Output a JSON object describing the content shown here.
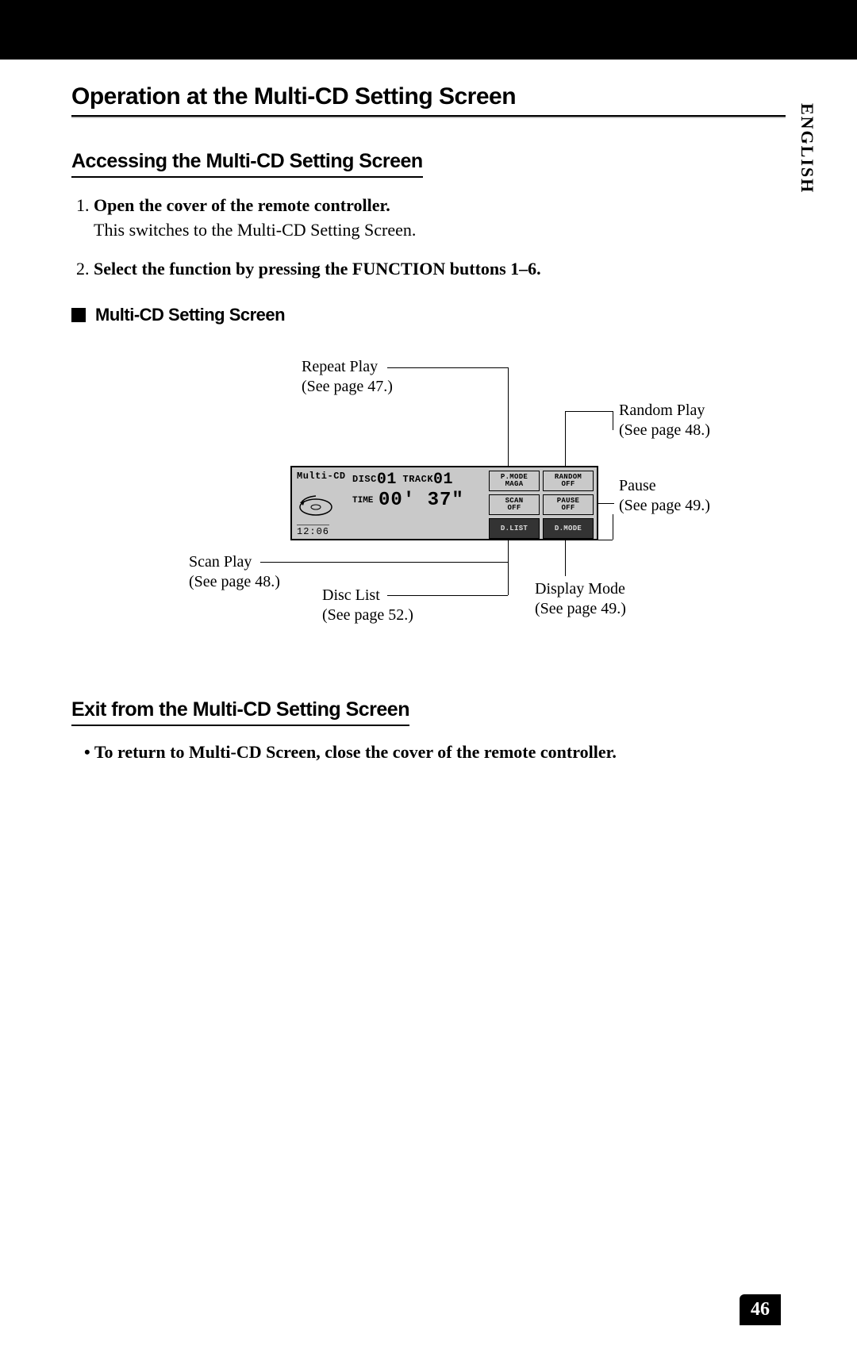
{
  "language_tab": "ENGLISH",
  "section_title": "Operation at the Multi-CD Setting Screen",
  "accessing": {
    "heading": "Accessing the Multi-CD Setting Screen",
    "steps": [
      {
        "main": "Open the cover of the remote controller.",
        "sub": "This switches to the Multi-CD Setting Screen."
      },
      {
        "main": "Select the function by pressing the FUNCTION buttons 1–6.",
        "sub": ""
      }
    ]
  },
  "screen_heading": "Multi-CD Setting Screen",
  "callouts": {
    "repeat": {
      "title": "Repeat Play",
      "ref": "(See page 47.)"
    },
    "random": {
      "title": "Random Play",
      "ref": "(See page 48.)"
    },
    "pause": {
      "title": "Pause",
      "ref": "(See page 49.)"
    },
    "scan": {
      "title": "Scan Play",
      "ref": "(See page 48.)"
    },
    "disclist": {
      "title": "Disc List",
      "ref": "(See page 52.)"
    },
    "dispmode": {
      "title": "Display Mode",
      "ref": "(See page 49.)"
    }
  },
  "lcd": {
    "label": "Multi-CD",
    "disc_label": "DISC",
    "disc_num": "01",
    "track_label": "TRACK",
    "track_num": "01",
    "time_label": "TIME",
    "time_value": "00' 37\"",
    "clock": "12:06",
    "buttons": {
      "pmode": {
        "l1": "P.MODE",
        "l2": "MAGA"
      },
      "random": {
        "l1": "RANDOM",
        "l2": "OFF"
      },
      "scan": {
        "l1": "SCAN",
        "l2": "OFF"
      },
      "pause": {
        "l1": "PAUSE",
        "l2": "OFF"
      },
      "dlist": {
        "l1": "D.LIST",
        "l2": ""
      },
      "dmode": {
        "l1": "D.MODE",
        "l2": ""
      }
    }
  },
  "exit": {
    "heading": "Exit from the Multi-CD Setting Screen",
    "bullet": "To return to Multi-CD Screen, close the cover of the remote controller."
  },
  "page_number": "46"
}
